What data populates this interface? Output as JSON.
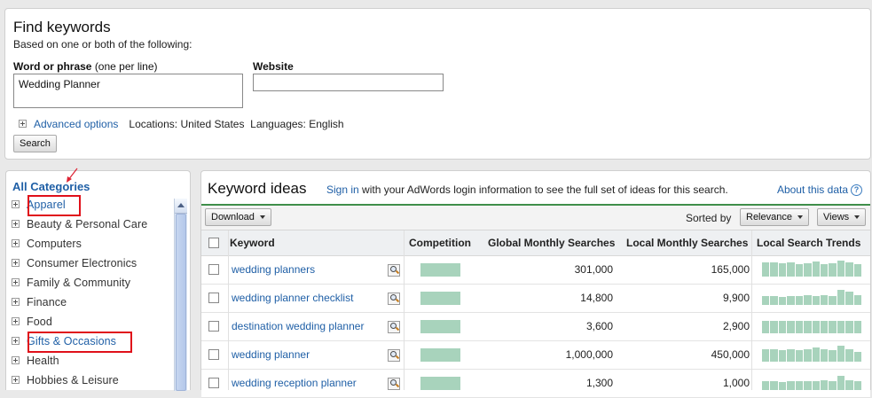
{
  "find": {
    "title": "Find keywords",
    "subtitle": "Based on one or both of the following:",
    "phrase_label": "Word or phrase",
    "phrase_hint": "(one per line)",
    "phrase_value": "Wedding Planner",
    "website_label": "Website",
    "website_value": "",
    "advanced_label": "Advanced options",
    "locations": "Locations: United States",
    "languages": "Languages: English",
    "search_button": "Search"
  },
  "categories": {
    "title": "All Categories",
    "items": [
      {
        "label": "Apparel",
        "highlighted": true,
        "link": true
      },
      {
        "label": "Beauty & Personal Care"
      },
      {
        "label": "Computers"
      },
      {
        "label": "Consumer Electronics"
      },
      {
        "label": "Family & Community"
      },
      {
        "label": "Finance"
      },
      {
        "label": "Food"
      },
      {
        "label": "Gifts & Occasions",
        "highlighted": true,
        "link": true
      },
      {
        "label": "Health"
      },
      {
        "label": "Hobbies & Leisure"
      }
    ]
  },
  "ideas": {
    "title": "Keyword ideas",
    "sign_in": "Sign in",
    "sign_in_text": "with your AdWords login information to see the full set of ideas for this search.",
    "about": "About this data",
    "download": "Download",
    "sorted_by": "Sorted by",
    "relevance": "Relevance",
    "views": "Views",
    "columns": {
      "keyword": "Keyword",
      "competition": "Competition",
      "global": "Global Monthly Searches",
      "local": "Local Monthly Searches",
      "trends": "Local Search Trends"
    },
    "rows": [
      {
        "keyword": "wedding planners",
        "global": "301,000",
        "local": "165,000",
        "trend": [
          0.9,
          0.9,
          0.85,
          0.9,
          0.8,
          0.85,
          0.95,
          0.8,
          0.85,
          1.0,
          0.9,
          0.75
        ]
      },
      {
        "keyword": "wedding planner checklist",
        "global": "14,800",
        "local": "9,900",
        "trend": [
          0.55,
          0.55,
          0.5,
          0.55,
          0.55,
          0.6,
          0.55,
          0.6,
          0.55,
          0.95,
          0.85,
          0.6
        ]
      },
      {
        "keyword": "destination wedding planner",
        "global": "3,600",
        "local": "2,900",
        "trend": [
          0.8,
          0.8,
          0.8,
          0.8,
          0.8,
          0.8,
          0.8,
          0.8,
          0.8,
          0.8,
          0.8,
          0.8
        ]
      },
      {
        "keyword": "wedding planner",
        "global": "1,000,000",
        "local": "450,000",
        "trend": [
          0.8,
          0.75,
          0.7,
          0.8,
          0.7,
          0.75,
          0.9,
          0.8,
          0.7,
          1.0,
          0.8,
          0.6
        ]
      },
      {
        "keyword": "wedding reception planner",
        "global": "1,300",
        "local": "1,000",
        "trend": [
          0.55,
          0.55,
          0.5,
          0.55,
          0.55,
          0.55,
          0.55,
          0.6,
          0.55,
          0.9,
          0.6,
          0.55
        ]
      }
    ]
  }
}
